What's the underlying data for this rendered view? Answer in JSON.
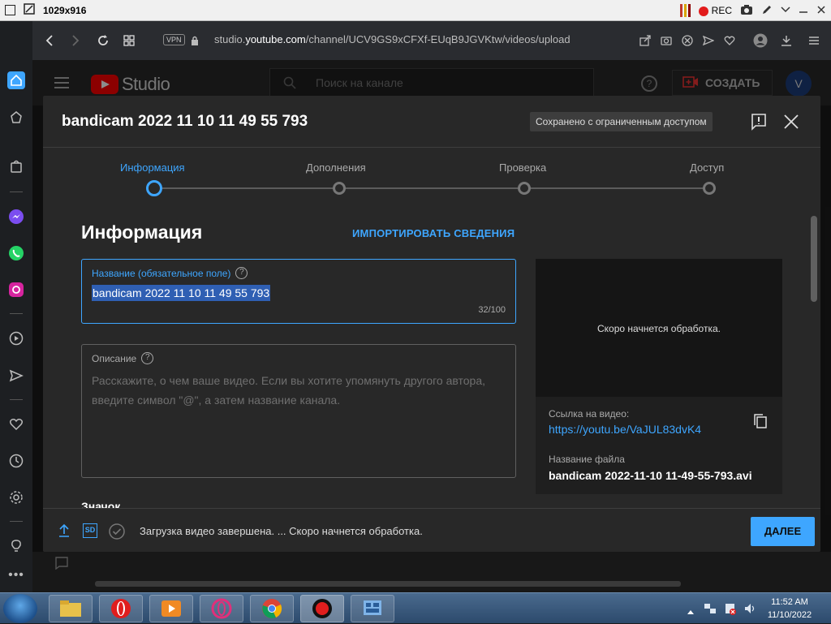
{
  "recorder": {
    "resolution": "1029x916",
    "rec_label": "REC"
  },
  "browser": {
    "vpn_label": "VPN",
    "url_host": "studio.youtube.com",
    "url_prefix": "studio.",
    "url_domain": "youtube.com",
    "url_path": "/channel/UCV9GS9xCFXf-EUqB9JGVKtw/videos/upload"
  },
  "studio_header": {
    "logo_text": "Studio",
    "search_placeholder": "Поиск на канале",
    "help_glyph": "?",
    "create_label": "СОЗДАТЬ",
    "avatar_letter": "V"
  },
  "dialog": {
    "title": "bandicam 2022 11 10 11 49 55 793",
    "saved_badge": "Сохранено с ограниченным доступом",
    "steps": [
      {
        "label": "Информация",
        "active": true
      },
      {
        "label": "Дополнения",
        "active": false
      },
      {
        "label": "Проверка",
        "active": false
      },
      {
        "label": "Доступ",
        "active": false
      }
    ],
    "section_title": "Информация",
    "import_label": "ИМПОРТИРОВАТЬ СВЕДЕНИЯ",
    "title_field": {
      "label": "Название (обязательное поле)",
      "value": "bandicam 2022 11 10 11 49 55 793",
      "counter": "32/100"
    },
    "description_field": {
      "label": "Описание",
      "placeholder": "Расскажите, о чем ваше видео. Если вы хотите упомянуть другого автора, введите символ \"@\", а затем название канала."
    },
    "thumbnail_label": "Значок",
    "preview": {
      "processing_text": "Скоро начнется обработка.",
      "link_label": "Ссылка на видео:",
      "link_value": "https://youtu.be/VaJUL83dvK4",
      "file_label": "Название файла",
      "file_value": "bandicam 2022-11-10 11-49-55-793.avi"
    },
    "footer": {
      "sd_label": "SD",
      "status_text": "Загрузка видео завершена. ... Скоро начнется обработка.",
      "next_label": "ДАЛЕЕ"
    }
  },
  "taskbar": {
    "time": "11:52 AM",
    "date": "11/10/2022"
  },
  "colors": {
    "accent": "#3ea6ff",
    "dialog_bg": "#282828",
    "selection": "#2f5fb3"
  }
}
